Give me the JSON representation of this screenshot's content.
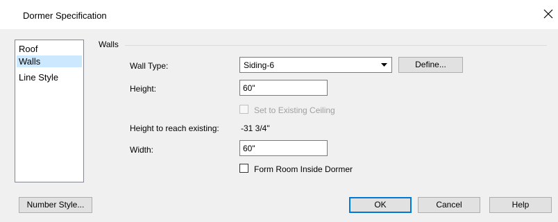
{
  "window": {
    "title": "Dormer Specification"
  },
  "nav": {
    "items": [
      {
        "label": "Roof",
        "selected": false
      },
      {
        "label": "Walls",
        "selected": true
      },
      {
        "label": "Line Style",
        "selected": false
      }
    ]
  },
  "walls": {
    "group_label": "Walls",
    "wall_type": {
      "label": "Wall Type:",
      "value": "Siding-6",
      "define_label": "Define..."
    },
    "height": {
      "label": "Height:",
      "value": "60\""
    },
    "set_to_existing_ceiling": {
      "label": "Set to Existing Ceiling",
      "checked": false,
      "disabled": true
    },
    "height_to_reach": {
      "label": "Height to reach existing:",
      "value": "-31 3/4\""
    },
    "width": {
      "label": "Width:",
      "value": "60\""
    },
    "form_room_inside_dormer": {
      "label": "Form Room Inside Dormer",
      "checked": false
    }
  },
  "footer": {
    "number_style_label": "Number Style...",
    "ok_label": "OK",
    "cancel_label": "Cancel",
    "help_label": "Help"
  },
  "icons": [
    "close-icon",
    "dropdown-arrow-icon"
  ],
  "colors": {
    "selection": "#cce8ff",
    "default_button_border": "#0078d7"
  }
}
